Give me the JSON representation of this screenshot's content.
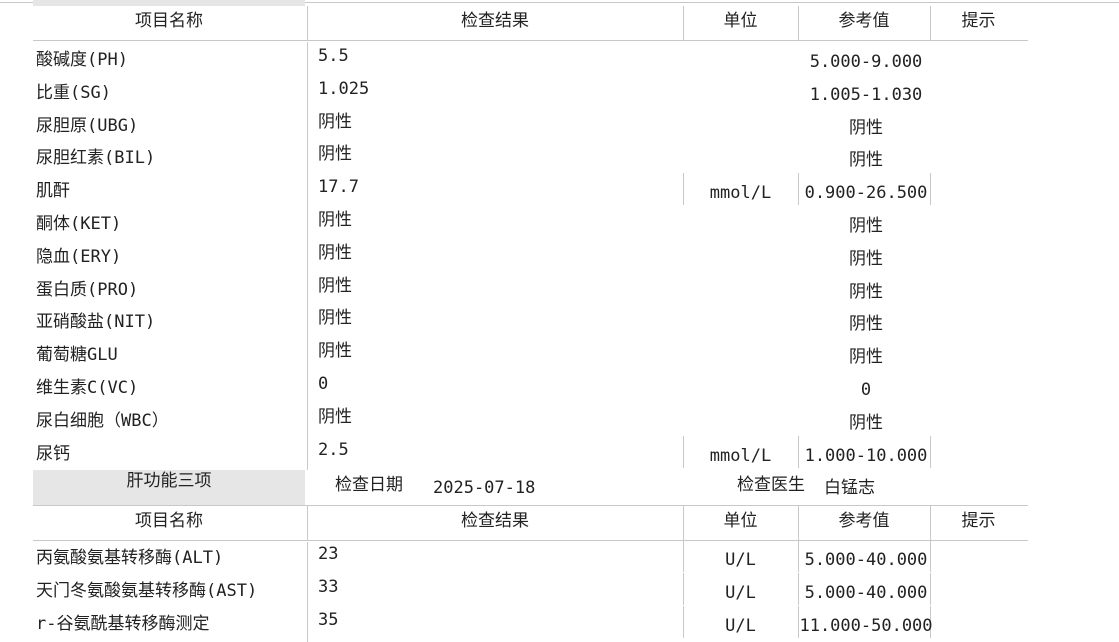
{
  "header1": {
    "name": "项目名称",
    "result": "检查结果",
    "unit": "单位",
    "ref": "参考值",
    "hint": "提示"
  },
  "urine_rows": [
    {
      "name": "酸碱度(PH)",
      "result": "5.5",
      "unit": "",
      "ref": "5.000-9.000"
    },
    {
      "name": "比重(SG)",
      "result": "1.025",
      "unit": "",
      "ref": "1.005-1.030"
    },
    {
      "name": "尿胆原(UBG)",
      "result": "阴性",
      "unit": "",
      "ref": "阴性"
    },
    {
      "name": "尿胆红素(BIL)",
      "result": "阴性",
      "unit": "",
      "ref": "阴性"
    },
    {
      "name": "肌酐",
      "result": "17.7",
      "unit": "mmol/L",
      "ref": "0.900-26.500"
    },
    {
      "name": "酮体(KET)",
      "result": "阴性",
      "unit": "",
      "ref": "阴性"
    },
    {
      "name": "隐血(ERY)",
      "result": "阴性",
      "unit": "",
      "ref": "阴性"
    },
    {
      "name": "蛋白质(PRO)",
      "result": "阴性",
      "unit": "",
      "ref": "阴性"
    },
    {
      "name": "亚硝酸盐(NIT)",
      "result": "阴性",
      "unit": "",
      "ref": "阴性"
    },
    {
      "name": "葡萄糖GLU",
      "result": "阴性",
      "unit": "",
      "ref": "阴性"
    },
    {
      "name": "维生素C(VC)",
      "result": "0",
      "unit": "",
      "ref": "0"
    },
    {
      "name": "尿白细胞（WBC）",
      "result": "阴性",
      "unit": "",
      "ref": "阴性"
    },
    {
      "name": "尿钙",
      "result": "2.5",
      "unit": "mmol/L",
      "ref": "1.000-10.000"
    }
  ],
  "section2": {
    "title": "肝功能三项",
    "date_label": "检查日期",
    "date_value": "2025-07-18",
    "doctor_label": "检查医生",
    "doctor_value": "白锰志"
  },
  "header2": {
    "name": "项目名称",
    "result": "检查结果",
    "unit": "单位",
    "ref": "参考值",
    "hint": "提示"
  },
  "liver_rows": [
    {
      "name": "丙氨酸氨基转移酶(ALT)",
      "result": "23",
      "unit": "U/L",
      "ref": "5.000-40.000"
    },
    {
      "name": "天门冬氨酸氨基转移酶(AST)",
      "result": "33",
      "unit": "U/L",
      "ref": "5.000-40.000"
    },
    {
      "name": "r-谷氨酰基转移酶测定",
      "result": "35",
      "unit": "U/L",
      "ref": "11.000-50.000"
    }
  ]
}
